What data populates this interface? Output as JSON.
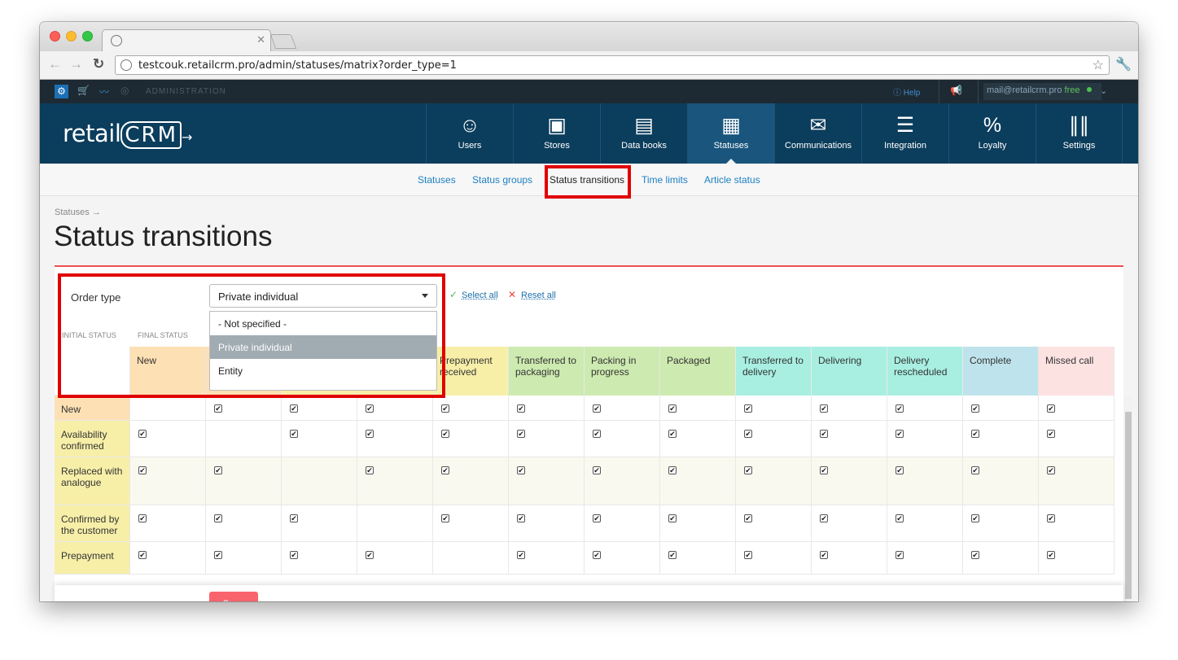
{
  "browser": {
    "url": "testcouk.retailcrm.pro/admin/statuses/matrix?order_type=1"
  },
  "topbar": {
    "section": "ADMINISTRATION",
    "help": "Help",
    "email": "mail@retailcrm.pro",
    "plan": "free"
  },
  "nav": {
    "logo": "retail",
    "logo_mark": "CRM",
    "items": [
      {
        "label": "Users",
        "icon": "user-icon"
      },
      {
        "label": "Stores",
        "icon": "store-icon"
      },
      {
        "label": "Data books",
        "icon": "book-icon"
      },
      {
        "label": "Statuses",
        "icon": "statuses-icon"
      },
      {
        "label": "Communications",
        "icon": "mail-icon"
      },
      {
        "label": "Integration",
        "icon": "integration-icon"
      },
      {
        "label": "Loyalty",
        "icon": "percent-icon"
      },
      {
        "label": "Settings",
        "icon": "sliders-icon"
      }
    ]
  },
  "subnav": [
    "Statuses",
    "Status groups",
    "Status transitions",
    "Time limits",
    "Article status"
  ],
  "breadcrumb": "Statuses →",
  "page_title": "Status transitions",
  "filter": {
    "label": "Order type",
    "selected": "Private individual",
    "options": [
      "- Not specified -",
      "Private individual",
      "Entity"
    ],
    "select_all": "Select all",
    "reset_all": "Reset all"
  },
  "matrix": {
    "initial_label": "INITIAL STATUS",
    "final_label": "FINAL STATUS",
    "columns": [
      {
        "label": "New",
        "color": "#fde0b3"
      },
      {
        "label": "",
        "color": "#fde0b3"
      },
      {
        "label": "",
        "color": "#f7efa8"
      },
      {
        "label": "",
        "color": "#f7efa8"
      },
      {
        "label": "Prepayment received",
        "color": "#f7efa8"
      },
      {
        "label": "Transferred to packaging",
        "color": "#cdeab0"
      },
      {
        "label": "Packing in progress",
        "color": "#cdeab0"
      },
      {
        "label": "Packaged",
        "color": "#cdeab0"
      },
      {
        "label": "Transferred to delivery",
        "color": "#a8efe2"
      },
      {
        "label": "Delivering",
        "color": "#a8efe2"
      },
      {
        "label": "Delivery rescheduled",
        "color": "#a8efe2"
      },
      {
        "label": "Complete",
        "color": "#bfe3ec"
      },
      {
        "label": "Missed call",
        "color": "#fde2e2"
      }
    ],
    "rows": [
      {
        "label": "New",
        "color": "#fde0b3",
        "empty": 0
      },
      {
        "label": "Availability confirmed",
        "color": "#f7efa8",
        "empty": 1
      },
      {
        "label": "Replaced with analogue",
        "color": "#f7efa8",
        "empty": 2
      },
      {
        "label": "Confirmed by the customer",
        "color": "#f7efa8",
        "empty": 3
      },
      {
        "label": "Prepayment",
        "color": "#f7efa8",
        "empty": 4
      }
    ]
  },
  "actions": {
    "save": "Save"
  }
}
